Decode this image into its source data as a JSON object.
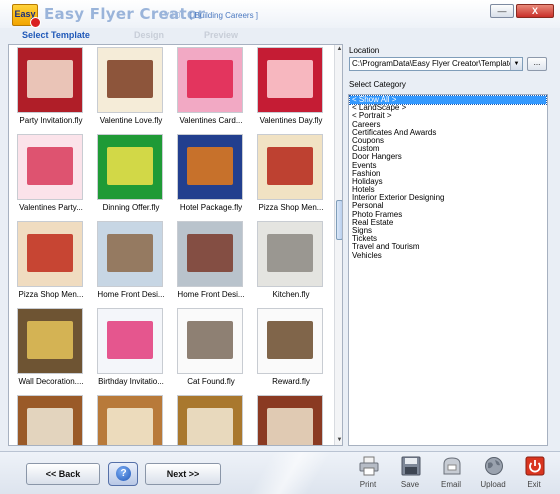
{
  "app": {
    "logo_text": "Easy",
    "title": "Easy Flyer Creator",
    "version": "V3.0",
    "tagline": "[ Building Careers ]"
  },
  "window_controls": {
    "minimize": "—",
    "close": "X"
  },
  "steps": [
    "Select Template",
    "Design",
    "Preview"
  ],
  "gallery": {
    "tiles": [
      {
        "label": "Party Invitation.fly",
        "bg": "#b01e28",
        "accent": "#f4e2d0"
      },
      {
        "label": "Valentine Love.fly",
        "bg": "#f5ecd8",
        "accent": "#7a3b20"
      },
      {
        "label": "Valentines  Card...",
        "bg": "#f2a9c4",
        "accent": "#e0214c"
      },
      {
        "label": "Valentines Day.fly",
        "bg": "#c51c34",
        "accent": "#ffd2d8"
      },
      {
        "label": "Valentines  Party...",
        "bg": "#fbe3ea",
        "accent": "#d83a5b"
      },
      {
        "label": "Dinning Offer.fly",
        "bg": "#1f9a36",
        "accent": "#f2e34a"
      },
      {
        "label": "Hotel Package.fly",
        "bg": "#223f8e",
        "accent": "#e47a1a"
      },
      {
        "label": "Pizza Shop Men...",
        "bg": "#f1e2c3",
        "accent": "#b52418"
      },
      {
        "label": "Pizza Shop Men...",
        "bg": "#f0dcc0",
        "accent": "#c02a1a"
      },
      {
        "label": "Home Front Desi...",
        "bg": "#c7d6e4",
        "accent": "#8c6a4a"
      },
      {
        "label": "Home Front Desi...",
        "bg": "#b9c3cc",
        "accent": "#7a3a2a"
      },
      {
        "label": "Kitchen.fly",
        "bg": "#e4e4e0",
        "accent": "#8d8a82"
      },
      {
        "label": "Wall Decoration....",
        "bg": "#6e5433",
        "accent": "#e6c45a"
      },
      {
        "label": "Birthday Invitatio...",
        "bg": "#f4f6fa",
        "accent": "#e23a7a"
      },
      {
        "label": "Cat Found.fly",
        "bg": "#fafafa",
        "accent": "#7a6a5a"
      },
      {
        "label": "Reward.fly",
        "bg": "#fafafa",
        "accent": "#6a4a2a"
      },
      {
        "label": "",
        "bg": "#9a5a28",
        "accent": "#f0ead8"
      },
      {
        "label": "",
        "bg": "#b87a3a",
        "accent": "#f4ecd4"
      },
      {
        "label": "",
        "bg": "#a9782e",
        "accent": "#f3ead6"
      },
      {
        "label": "",
        "bg": "#8a3a22",
        "accent": "#efe4cc"
      }
    ]
  },
  "location": {
    "label": "Location",
    "value": "C:\\ProgramData\\Easy Flyer Creator\\Templates",
    "browse_label": "..."
  },
  "category": {
    "label": "Select Category",
    "items": [
      "< Show All >",
      "< LandScape >",
      "< Portrait >",
      "Careers",
      "Certificates And Awards",
      "Coupons",
      "Custom",
      "Door Hangers",
      "Events",
      "Fashion",
      "Holidays",
      "Hotels",
      "Interior Exterior Designing",
      "Personal",
      "Photo Frames",
      "Real Estate",
      "Signs",
      "Tickets",
      "Travel and Tourism",
      "Vehicles"
    ],
    "selected": "< Show All >"
  },
  "footer": {
    "back_label": "<< Back",
    "help_label": "?",
    "next_label": "Next >>",
    "tools": {
      "print": "Print",
      "save": "Save",
      "email": "Email",
      "upload": "Upload",
      "exit": "Exit"
    }
  },
  "colors": {
    "accent": "#1f58b8",
    "selection": "#3399ff",
    "exit_red": "#d9351f"
  }
}
